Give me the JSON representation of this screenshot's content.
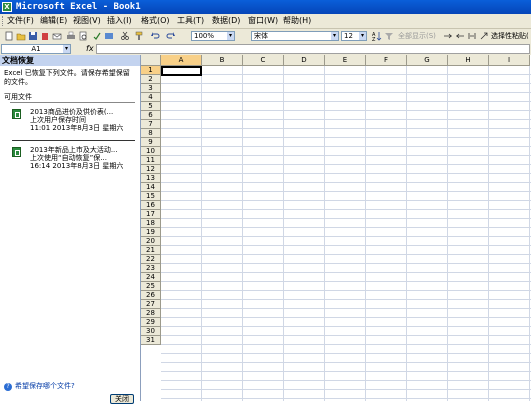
{
  "window": {
    "title": "Microsoft Excel - Book1",
    "app_icon": "X"
  },
  "menu": [
    "文件(F)",
    "编辑(E)",
    "视图(V)",
    "插入(I)",
    "格式(O)",
    "工具(T)",
    "数据(D)",
    "窗口(W)",
    "帮助(H)"
  ],
  "toolbar": {
    "zoom": "100%",
    "font": "宋体",
    "size": "12",
    "sort_label": "全部显示(S)",
    "filter_label": "选择性粘贴(",
    "icons": [
      "new-icon",
      "open-icon",
      "save-icon",
      "permission-icon",
      "email-icon",
      "print-icon",
      "print-preview-icon",
      "spelling-icon",
      "research-icon",
      "cut-icon",
      "copy-icon",
      "paste-icon",
      "format-painter-icon",
      "undo-icon",
      "redo-icon"
    ]
  },
  "formula_bar": {
    "name_box": "A1",
    "fx_label": "fx",
    "value": ""
  },
  "task_pane": {
    "title": "文档恢复",
    "message": "Excel 已恢复下列文件。请保存希望保留的文件。",
    "available_label": "可用文件",
    "files": [
      {
        "name": "2013商品进价及供价表(...",
        "status": "上次用户保存时间",
        "time": "11:01 2013年8月3日 星期六"
      },
      {
        "name": "2013年新品上市及大活动...",
        "status": "上次使用“自动恢复”保...",
        "time": "16:14 2013年8月3日 星期六"
      }
    ],
    "help_link": "希望保存哪个文件?",
    "close_button": "关闭"
  },
  "sheet": {
    "columns": [
      "A",
      "B",
      "C",
      "D",
      "E",
      "F",
      "G",
      "H",
      "I"
    ],
    "rows": [
      "1",
      "2",
      "3",
      "4",
      "5",
      "6",
      "7",
      "8",
      "9",
      "10",
      "11",
      "12",
      "13",
      "14",
      "15",
      "16",
      "17",
      "18",
      "19",
      "20",
      "21",
      "22",
      "23",
      "24",
      "25",
      "26",
      "27",
      "28",
      "29",
      "30",
      "31"
    ],
    "active_cell": "A1"
  }
}
